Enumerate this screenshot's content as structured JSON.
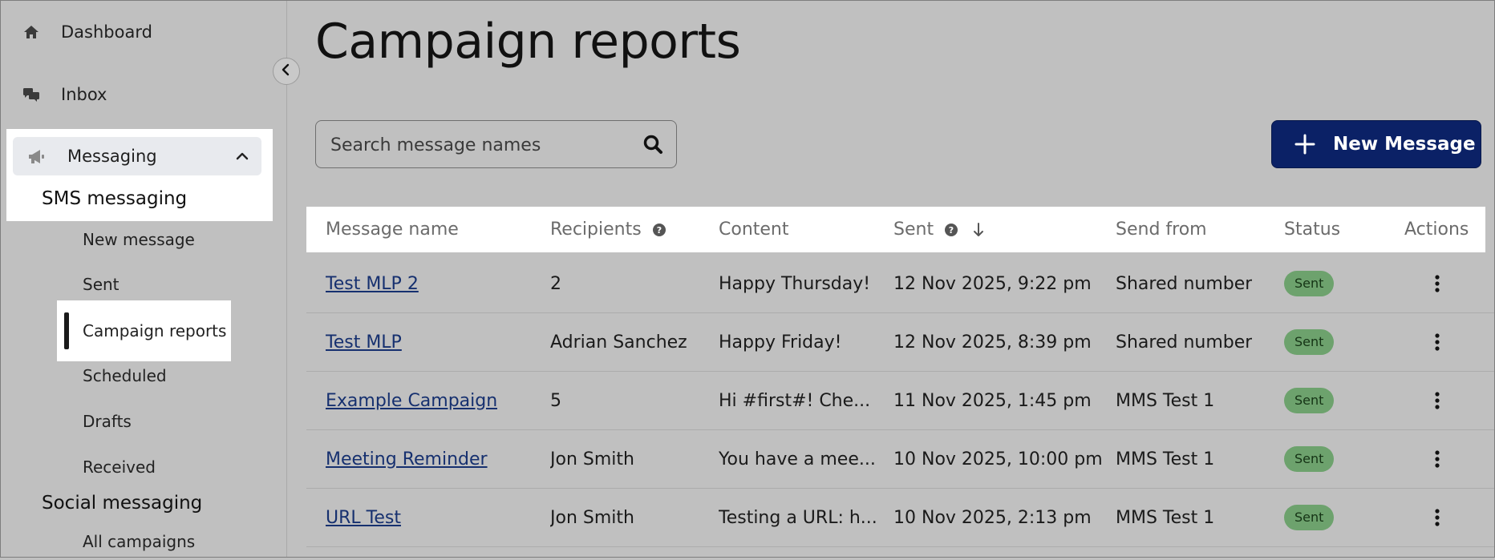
{
  "sidebar": {
    "dashboard": {
      "label": "Dashboard",
      "icon": "home-icon"
    },
    "inbox": {
      "label": "Inbox",
      "icon": "chat-bubbles-icon"
    },
    "messaging": {
      "label": "Messaging",
      "icon": "megaphone-icon"
    },
    "sms_heading": "SMS messaging",
    "sms_items": [
      {
        "label": "New message"
      },
      {
        "label": "Sent"
      },
      {
        "label": "Campaign reports",
        "active": true
      },
      {
        "label": "Scheduled"
      },
      {
        "label": "Drafts"
      },
      {
        "label": "Received"
      }
    ],
    "social_heading": "Social messaging",
    "social_items": [
      {
        "label": "All campaigns"
      }
    ]
  },
  "page": {
    "title": "Campaign reports"
  },
  "search": {
    "placeholder": "Search message names",
    "value": ""
  },
  "new_message_button": {
    "label": "New Message"
  },
  "table": {
    "headers": {
      "name": "Message name",
      "recipients": "Recipients",
      "content": "Content",
      "sent": "Sent",
      "send_from": "Send from",
      "status": "Status",
      "actions": "Actions"
    },
    "rows": [
      {
        "name": "Test MLP 2",
        "recipients": "2",
        "content": "Happy Thursday!",
        "sent": "12 Nov 2025, 9:22 pm",
        "send_from": "Shared number",
        "status": "Sent"
      },
      {
        "name": "Test MLP",
        "recipients": "Adrian Sanchez",
        "content": "Happy Friday!",
        "sent": "12 Nov 2025, 8:39 pm",
        "send_from": "Shared number",
        "status": "Sent"
      },
      {
        "name": "Example Campaign",
        "recipients": "5",
        "content": "Hi #first#! Che...",
        "sent": "11 Nov 2025, 1:45 pm",
        "send_from": "MMS Test 1",
        "status": "Sent"
      },
      {
        "name": "Meeting Reminder",
        "recipients": "Jon Smith",
        "content": "You have a mee...",
        "sent": "10 Nov 2025, 10:00 pm",
        "send_from": "MMS Test 1",
        "status": "Sent"
      },
      {
        "name": "URL Test",
        "recipients": "Jon Smith",
        "content": "Testing a URL: h...",
        "sent": "10 Nov 2025, 2:13 pm",
        "send_from": "MMS Test 1",
        "status": "Sent"
      }
    ]
  },
  "colors": {
    "background": "#c0c0c0",
    "primary_button": "#0b2166",
    "status_badge": "#6da26d",
    "link": "#16306f"
  }
}
